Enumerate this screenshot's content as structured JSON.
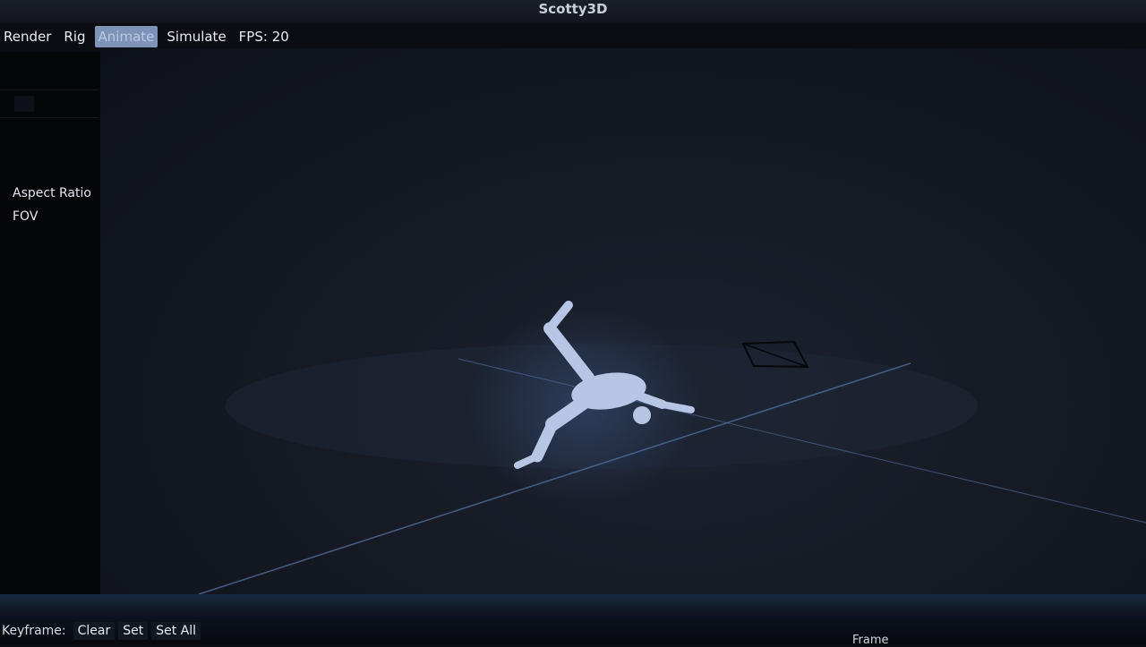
{
  "app": {
    "title": "Scotty3D"
  },
  "menu": {
    "items": [
      {
        "label": "Render",
        "active": false
      },
      {
        "label": "Rig",
        "active": false
      },
      {
        "label": "Animate",
        "active": true
      },
      {
        "label": "Simulate",
        "active": false
      }
    ],
    "fps": "FPS: 20"
  },
  "properties": {
    "aspect_ratio_label": "Aspect Ratio",
    "fov_label": "FOV"
  },
  "timeline": {
    "keyframe_label": "Keyframe:",
    "clear_label": "Clear",
    "set_label": "Set",
    "set_all_label": "Set All",
    "frame_label": "Frame"
  },
  "colors": {
    "active_tab": "#7f93b8",
    "figure": "#b7c6e4",
    "axis_line": "#4f6a95"
  }
}
